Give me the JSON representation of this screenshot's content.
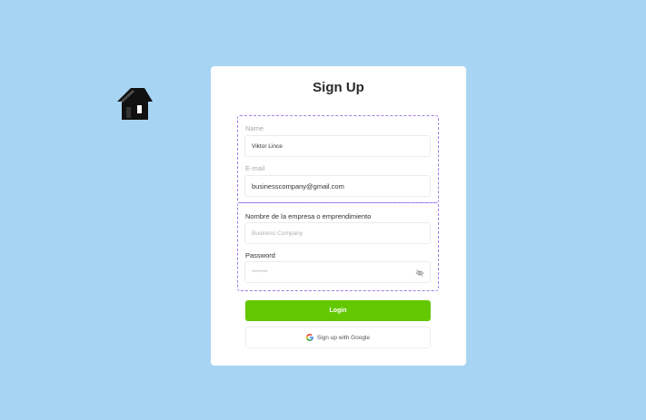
{
  "logo": {
    "icon": "house-icon"
  },
  "form": {
    "title": "Sign Up",
    "name": {
      "label": "Name",
      "value": "Viktor Lince"
    },
    "email": {
      "label": "E-mail",
      "value": "businesscompany@gmail.com"
    },
    "company": {
      "label": "Nombre de la empresa o emprendimiento",
      "placeholder": "Business Company"
    },
    "password": {
      "label": "Password",
      "value": "*******",
      "toggle_icon": "eye-off-icon"
    },
    "login_label": "Login",
    "google_label": "Sign up with Google",
    "google_icon": "google-icon"
  },
  "colors": {
    "background": "#a8d4f3",
    "primary": "#63c800",
    "dashed_border": "#a07ce8"
  }
}
